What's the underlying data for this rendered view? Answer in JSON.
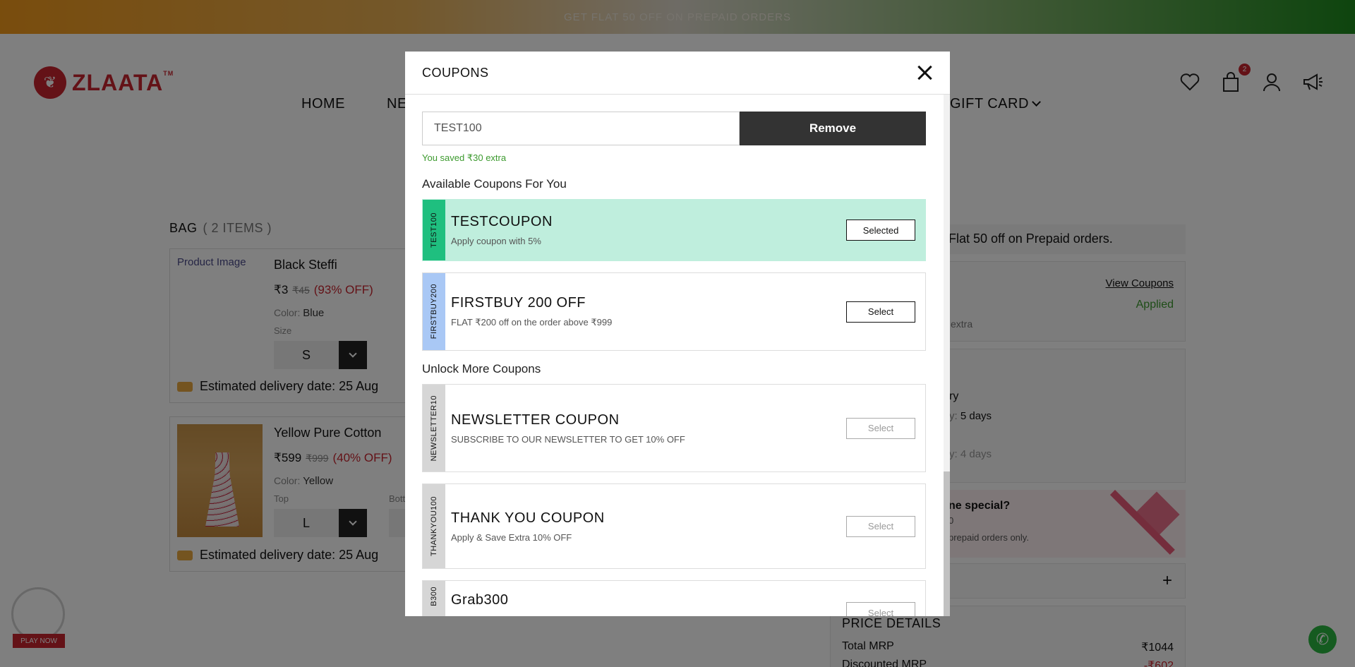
{
  "promo": {
    "text": "GET FLAT 50 OFF ON PREPAID ORDERS"
  },
  "brand": {
    "name": "ZLAATA",
    "tm": "TM"
  },
  "nav": {
    "home": "HOME",
    "partial": "NE",
    "gift_card": "GIFT CARD"
  },
  "header": {
    "cart_count": "2"
  },
  "bag": {
    "title": "BAG",
    "count": "( 2 ITEMS )",
    "items": [
      {
        "image_alt": "Product Image",
        "name": "Black Steffi",
        "price": "₹3",
        "mrp": "₹45",
        "discount": "(93% OFF)",
        "color_label": "Color:",
        "color": "Blue",
        "size_label": "Size",
        "size": "S",
        "delivery": "Estimated delivery date: 25 Aug"
      },
      {
        "name": "Yellow Pure Cotton",
        "price": "₹599",
        "mrp": "₹999",
        "discount": "(40% OFF)",
        "color_label": "Color:",
        "color": "Yellow",
        "top_label": "Top",
        "bottom_label": "Bott",
        "size": "L",
        "delivery": "Estimated delivery date: 25 Aug"
      }
    ]
  },
  "summary": {
    "promo_text": "Flat 50 off on Prepaid orders.",
    "view_coupons": "View Coupons",
    "applied": "Applied",
    "extra": "extra",
    "delivery_heading": "ry",
    "delivery_line1_suffix": "y:",
    "delivery_line1_value": "5 days",
    "delivery_line2_suffix": "y:",
    "delivery_line2_value": "4 days",
    "gift_title": "ne special?",
    "gift_sub": "0",
    "gift_note": "prepaid orders only.",
    "addon_plus": "+",
    "price_details": "PRICE DETAILS",
    "total_mrp_label": "Total MRP",
    "total_mrp": "₹1044",
    "discounted_mrp_label": "Discounted MRP",
    "discounted_mrp": "-₹602"
  },
  "play_now": "PLAY NOW",
  "modal": {
    "title": "COUPONS",
    "code_value": "TEST100",
    "remove_label": "Remove",
    "saved_msg": "You saved ₹30 extra",
    "available_heading": "Available Coupons For You",
    "unlock_heading": "Unlock More Coupons",
    "available": [
      {
        "code": "TEST100",
        "title": "TESTCOUPON",
        "desc": "Apply coupon with 5%",
        "button": "Selected",
        "tag_color": "#1fbf7f"
      },
      {
        "code": "FIRSTBUY200",
        "title": "FIRSTBUY 200 OFF",
        "desc": "FLAT ₹200 off on the order above ₹999",
        "button": "Select",
        "tag_color": "#a9c8f5"
      }
    ],
    "locked": [
      {
        "code": "NEWSLETTER10",
        "title": "NEWSLETTER COUPON",
        "desc": "SUBSCRIBE TO OUR NEWSLETTER TO GET 10% OFF",
        "button": "Select",
        "tag_color": "#d6d6d6"
      },
      {
        "code": "THANKYOU100",
        "title": "THANK YOU COUPON",
        "desc": "Apply & Save Extra 10% OFF",
        "button": "Select",
        "tag_color": "#d6d6d6"
      },
      {
        "code": "B300",
        "title": "Grab300",
        "desc": "",
        "button": "Select",
        "tag_color": "#d6d6d6"
      }
    ]
  }
}
